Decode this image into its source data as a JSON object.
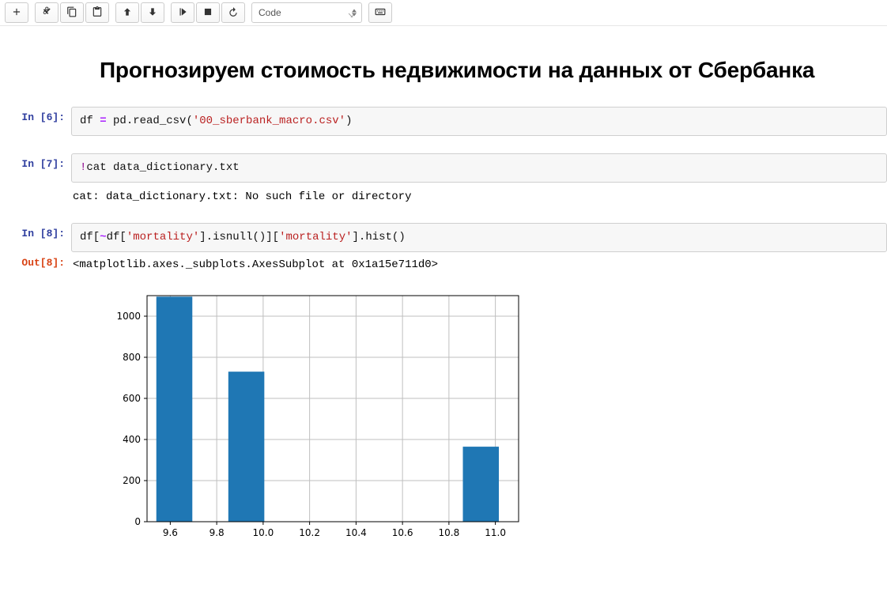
{
  "toolbar": {
    "cell_type": "Code"
  },
  "heading": "Прогнозируем стоимость недвижимости на данных от Сбербанка",
  "cells": {
    "c6": {
      "prompt": "In [6]:",
      "code_pre": "df ",
      "code_op": "=",
      "code_mid": " pd.read_csv(",
      "code_str": "'00_sberbank_macro.csv'",
      "code_post": ")"
    },
    "c7": {
      "prompt": "In [7]:",
      "magic_bang": "!",
      "magic_rest": "cat data_dictionary.txt",
      "stdout": "cat: data_dictionary.txt: No such file or directory"
    },
    "c8": {
      "prompt": "In [8]:",
      "code_a": "df[",
      "code_not": "~",
      "code_b": "df[",
      "code_str1": "'mortality'",
      "code_c": "].isnull()][",
      "code_str2": "'mortality'",
      "code_d": "].hist()",
      "out_prompt": "Out[8]:",
      "repr": "<matplotlib.axes._subplots.AxesSubplot at 0x1a15e711d0>"
    }
  },
  "chart_data": {
    "type": "bar",
    "title": "",
    "xlabel": "",
    "ylabel": "",
    "xlim": [
      9.5,
      11.1
    ],
    "ylim": [
      0,
      1100
    ],
    "yticks": [
      0,
      200,
      400,
      600,
      800,
      1000
    ],
    "xticks": [
      9.6,
      9.8,
      10.0,
      10.2,
      10.4,
      10.6,
      10.8,
      11.0
    ],
    "bin_width": 0.155,
    "bars": [
      {
        "x_left": 9.54,
        "value": 1095
      },
      {
        "x_left": 9.85,
        "value": 730
      },
      {
        "x_left": 10.86,
        "value": 365
      }
    ]
  }
}
